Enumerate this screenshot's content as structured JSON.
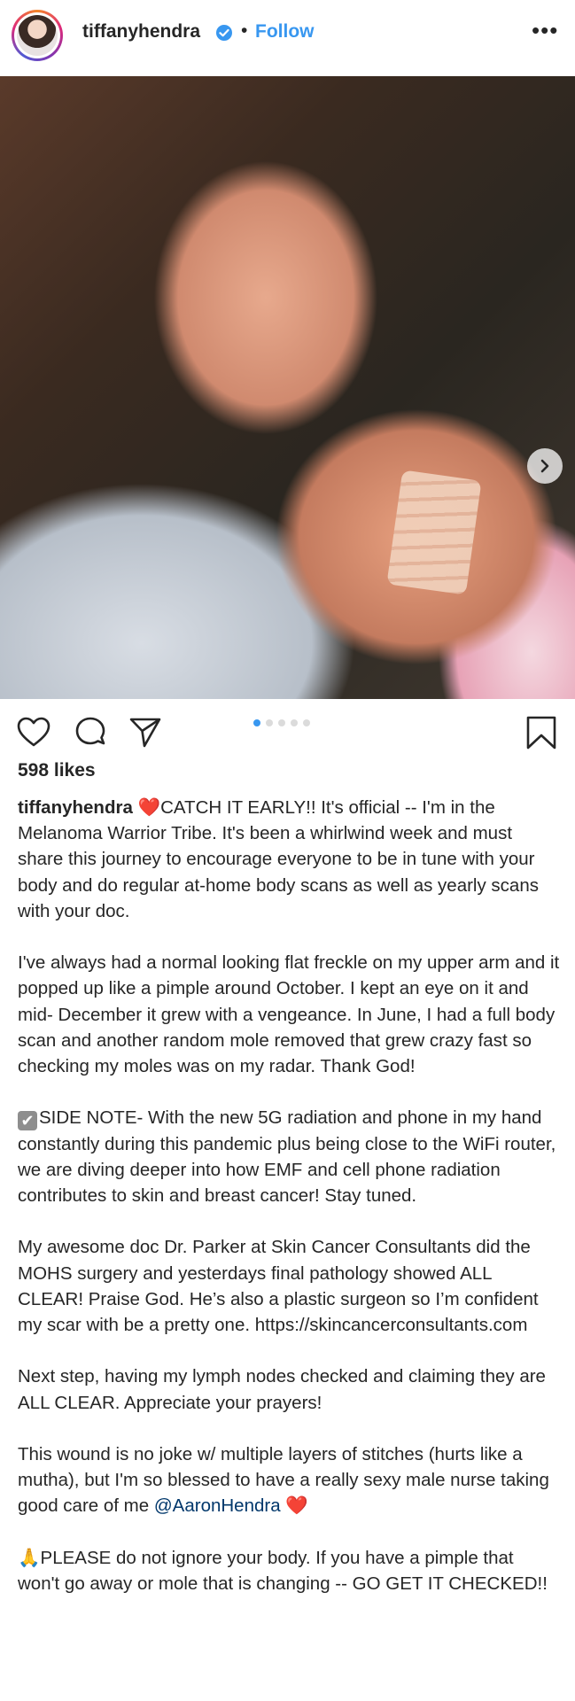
{
  "header": {
    "username": "tiffanyhendra",
    "separator": "•",
    "follow_label": "Follow",
    "more_label": "•••"
  },
  "icons": {
    "verified": "verified-badge-icon",
    "next": "chevron-right-icon",
    "like": "heart-outline-icon",
    "comment": "comment-bubble-icon",
    "share": "paper-plane-icon",
    "save": "bookmark-icon"
  },
  "colors": {
    "link_blue": "#3897f0",
    "heart_red": "#e0245e"
  },
  "carousel": {
    "total": 5,
    "active_index": 1
  },
  "post": {
    "likes": "598 likes",
    "caption_user": "tiffanyhendra",
    "heart_glyph": "❤️",
    "p1": "CATCH IT EARLY!! It's official -- I'm in the Melanoma Warrior Tribe. It's been a whirlwind week and must share this journey to encourage everyone to be in tune with your body and do regular at-home body scans as well as yearly scans with your doc.",
    "p2": "I've always had a normal looking flat freckle on my upper arm and it popped up like a pimple around October. I kept an eye on it and mid- December it grew with a vengeance. In June, I had a full body scan and another random mole removed that grew crazy fast so checking my moles was on my radar. Thank God!",
    "p3_check": "✔",
    "p3": "SIDE NOTE- With the new 5G radiation and phone in my hand constantly during this pandemic plus being close to the WiFi router, we are diving deeper into how EMF and cell phone radiation contributes to skin and breast cancer! Stay tuned.",
    "p4": "My awesome doc Dr. Parker at Skin Cancer Consultants did the MOHS surgery and yesterdays final pathology showed ALL CLEAR! Praise God. He’s also a plastic surgeon so I’m confident my scar with be a pretty one. https://skincancerconsultants.com",
    "p5": "Next step, having my lymph nodes checked and claiming they are ALL CLEAR. Appreciate your prayers!",
    "p6": "This wound is no joke w/ multiple layers of stitches (hurts like a mutha), but I'm so blessed to have a really sexy male nurse taking good care of me",
    "p6_mention": "@AaronHendra",
    "p6_heart": "❤️",
    "p7_icon": "🙏",
    "p7": "PLEASE do not ignore your body. If you have a pimple that won't go away or mole that is changing -- GO GET IT CHECKED!!"
  }
}
